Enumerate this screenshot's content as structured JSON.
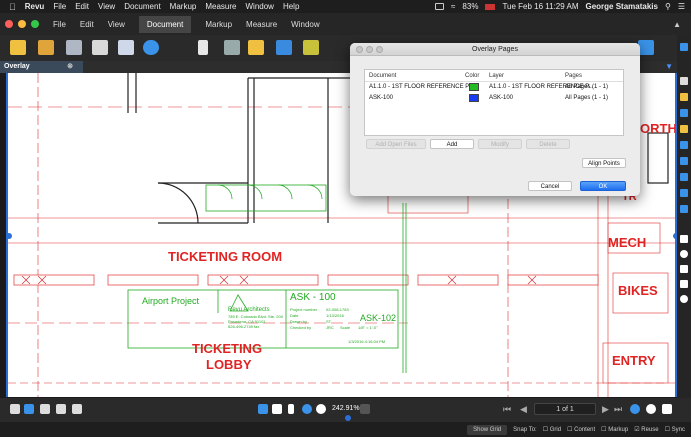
{
  "menubar": {
    "apple": "",
    "items": [
      "Revu",
      "File",
      "Edit",
      "View",
      "Document",
      "Markup",
      "Measure",
      "Window",
      "Help"
    ],
    "battery": "83%",
    "datetime": "Tue Feb 16  11:29 AM",
    "user": "George Stamatakis"
  },
  "window": {
    "tabs": [
      "File",
      "Edit",
      "View",
      "Document",
      "Markup",
      "Measure",
      "Window"
    ],
    "active_tab": "Document"
  },
  "panel": {
    "title": "Overlay"
  },
  "drawing": {
    "rooms": [
      "TICKETING ROOM",
      "TICKETING",
      "LOBBY",
      "ORTH",
      "TR",
      "MECH",
      "BIKES",
      "ENTRY"
    ],
    "titleblock": {
      "project": "Airport Project",
      "firm": "Revu Architects",
      "address1": "789 E. Colorado Blvd. Ste. 200",
      "address2": "Pasadena, CA 91101",
      "phone": "626-496-2749 fax",
      "sheet": "ASK - 100",
      "sheet2": "ASK-102",
      "fields": [
        "Project number",
        "Date",
        "Drawn by",
        "Checked by"
      ],
      "values": [
        "02-008-1783",
        "1/13/2016",
        "ST",
        "JRC"
      ],
      "scale_label": "Scale",
      "scale": "1/8\" = 1'-0\"",
      "timestamp": "1/3/2016 4:16:04 PM"
    }
  },
  "dialog": {
    "title": "Overlay Pages",
    "headers": [
      "Document",
      "Color",
      "Layer",
      "Pages"
    ],
    "rows": [
      {
        "document": "A1.1.0 - 1ST FLOOR REFERENCE P...",
        "color": "#22bb22",
        "layer": "A1.1.0 - 1ST FLOOR REFERENCE P...",
        "pages": "All Pages (1 - 1)"
      },
      {
        "document": "ASK-100",
        "color": "#1a3cf0",
        "layer": "ASK-100",
        "pages": "All Pages (1 - 1)"
      }
    ],
    "buttons": {
      "add_open_files": "Add Open Files",
      "add": "Add",
      "modify": "Modify",
      "delete": "Delete",
      "align_points": "Align Points",
      "cancel": "Cancel",
      "ok": "OK"
    }
  },
  "bottom": {
    "zoom": "242.91%",
    "page": "1 of 1"
  },
  "status": {
    "show_grid": "Show Grid",
    "snap_to": "Snap To:",
    "grid": "Grid",
    "content": "Content",
    "markup": "Markup",
    "reuse": "Reuse",
    "sync": "Sync"
  }
}
